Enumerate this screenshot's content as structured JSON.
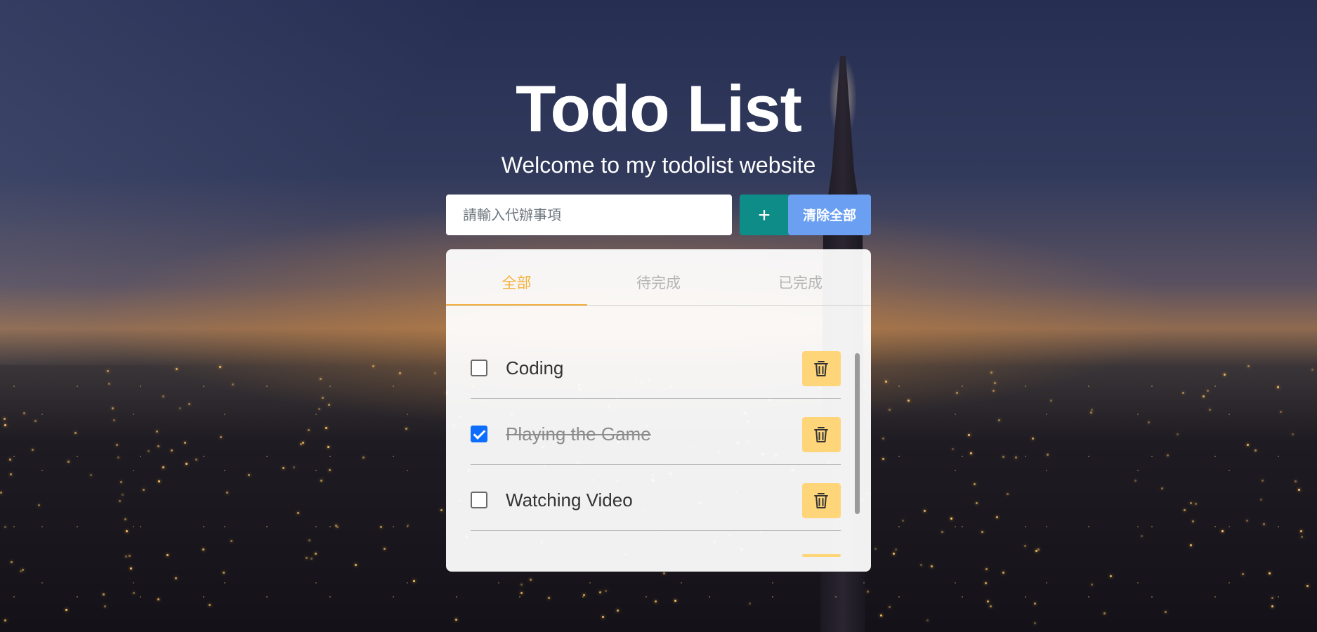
{
  "header": {
    "title": "Todo List",
    "subtitle": "Welcome to my todolist website"
  },
  "input": {
    "placeholder": "請輸入代辦事項",
    "value": ""
  },
  "buttons": {
    "add_label": "+",
    "clear_label": "清除全部"
  },
  "tabs": [
    {
      "label": "全部",
      "active": true
    },
    {
      "label": "待完成",
      "active": false
    },
    {
      "label": "已完成",
      "active": false
    }
  ],
  "todos": [
    {
      "text": "Coding",
      "done": false
    },
    {
      "text": "Playing the Game",
      "done": true
    },
    {
      "text": "Watching Video",
      "done": false
    }
  ],
  "colors": {
    "accent": "#f5b23e",
    "add_button": "#0e8c88",
    "clear_button": "#6a9ff2",
    "delete_button": "#ffd57a",
    "checkbox_checked": "#0d6efd"
  },
  "icons": {
    "delete": "trash-icon",
    "add": "plus-icon"
  }
}
